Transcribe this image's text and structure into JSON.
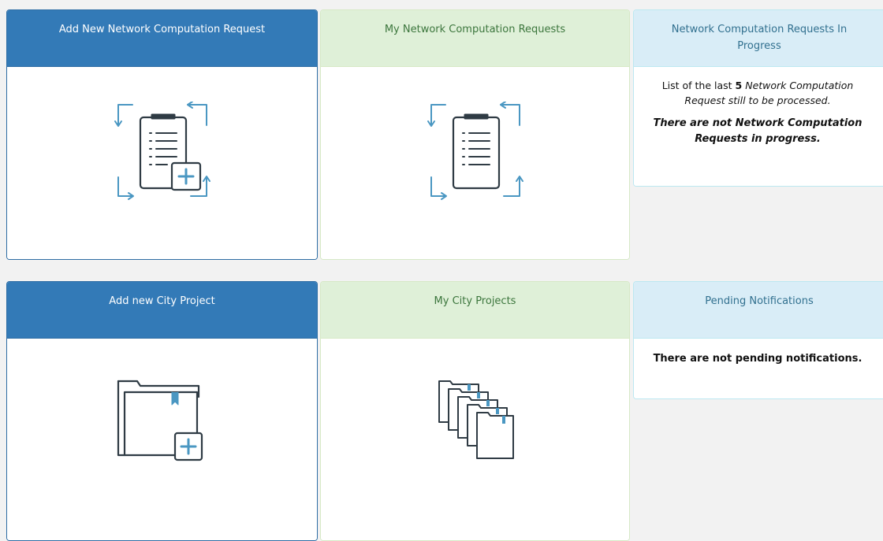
{
  "colors": {
    "primary": "#337ab7",
    "success_bg": "#dff0d8",
    "success_text": "#3c763d",
    "info_bg": "#d9edf7",
    "info_text": "#31708f",
    "icon_dark": "#2f3b44",
    "icon_accent": "#4a97c2"
  },
  "tiles": {
    "add_network_request": {
      "title": "Add New Network Computation Request",
      "icon": "clipboard-add-icon"
    },
    "my_network_requests": {
      "title": "My Network Computation Requests",
      "icon": "clipboard-list-icon"
    },
    "requests_in_progress": {
      "title": "Network Computation Requests In Progress",
      "list_prefix": "List of the last ",
      "list_count": "5",
      "list_suffix": " Network Computation Request still to be processed.",
      "empty_message": "There are not Network Computation Requests in progress."
    },
    "add_city_project": {
      "title": "Add new City Project",
      "icon": "folder-add-icon"
    },
    "my_city_projects": {
      "title": "My City Projects",
      "icon": "folder-stack-icon"
    },
    "pending_notifications": {
      "title": "Pending Notifications",
      "empty_message": "There are not pending notifications."
    }
  }
}
